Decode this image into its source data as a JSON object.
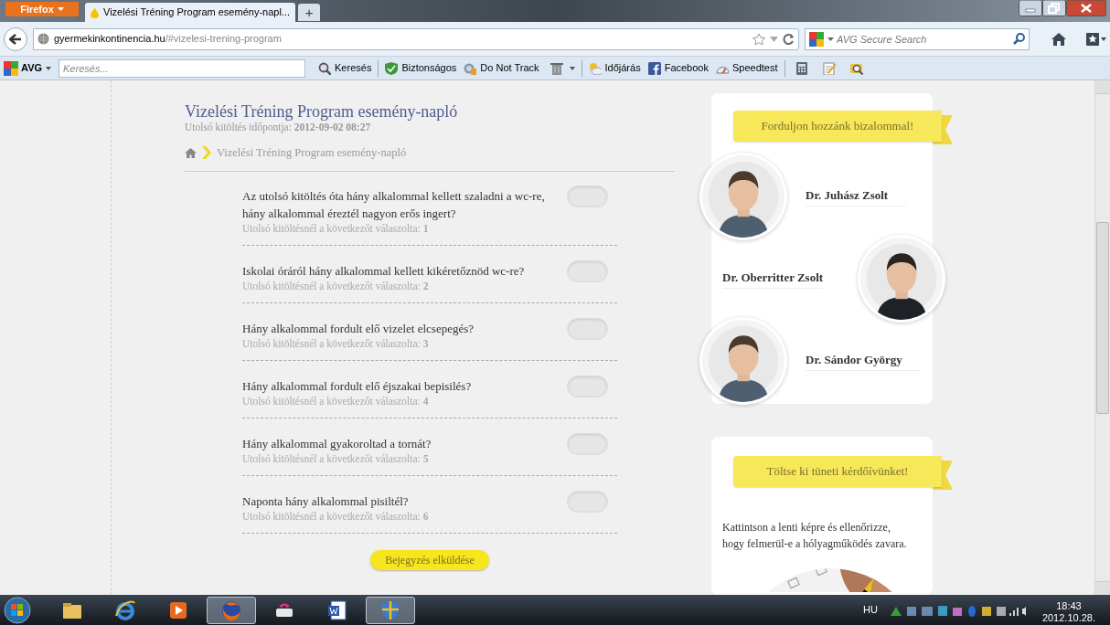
{
  "browser": {
    "menu_button": "Firefox",
    "tabs": [
      {
        "title": "Vizelési Tréning Program esemény-napl...",
        "selected": true
      }
    ],
    "new_tab": "+",
    "address": {
      "domain": "gyermekinkontinencia.hu",
      "path": "/#vizelesi-trening-program"
    },
    "search_placeholder": "AVG Secure Search",
    "toolbar": {
      "brand": "AVG",
      "search_placeholder": "Keresés...",
      "items": [
        {
          "kind": "search",
          "label": "Keresés"
        },
        {
          "kind": "shield",
          "label": "Biztonságos"
        },
        {
          "kind": "dnt",
          "label": "Do Not Track"
        },
        {
          "kind": "trash"
        },
        {
          "kind": "weather",
          "label": "Időjárás"
        },
        {
          "kind": "facebook",
          "label": "Facebook"
        },
        {
          "kind": "speedtest",
          "label": "Speedtest"
        },
        {
          "kind": "calculator"
        },
        {
          "kind": "notepad"
        },
        {
          "kind": "magnifier"
        }
      ]
    }
  },
  "page": {
    "title": "Vizelési Tréning Program esemény-napló",
    "last_filled": "Utolsó kitöltés időpontja: **2012-09-02 08:27**",
    "breadcrumb": "Vizelési Tréning Program esemény-napló",
    "questions": [
      {
        "text": "Az utolsó kitöltés óta hány alkalommal kellett szaladni a wc-re, hány alkalommal éreztél nagyon erős ingert?",
        "previous": "Utolsó kitöltésnél a következőt válaszolta: **1**"
      },
      {
        "text": "Iskolai óráról hány alkalommal kellett kikéretőznöd wc-re?",
        "previous": "Utolsó kitöltésnél a következőt válaszolta: **2**"
      },
      {
        "text": "Hány alkalommal fordult elő vizelet elcsepegés?",
        "previous": "Utolsó kitöltésnél a következőt válaszolta: **3**"
      },
      {
        "text": "Hány alkalommal fordult elő éjszakai bepisilés?",
        "previous": "Utolsó kitöltésnél a következőt válaszolta: **4**"
      },
      {
        "text": "Hány alkalommal gyakoroltad a tornát?",
        "previous": "Utolsó kitöltésnél a következőt válaszolta: **5**"
      },
      {
        "text": "Naponta hány alkalommal pisiltél?",
        "previous": "Utolsó kitöltésnél a következőt válaszolta: **6**"
      }
    ],
    "submit": "Bejegyzés elküldése"
  },
  "sidebar": {
    "contact_ribbon": "Forduljon hozzánk bizalommal!",
    "doctors": [
      {
        "name": "Dr. Juhász Zsolt",
        "kind": "photo_left"
      },
      {
        "name": "Dr. Oberritter Zsolt",
        "kind": "photo_right"
      },
      {
        "name": "Dr. Sándor György",
        "kind": "photo_left"
      }
    ],
    "survey_ribbon": "Töltse ki tüneti kérdőívünket!",
    "survey_text": "Kattintson a lenti képre és ellenőrizze, hogy felmerül-e a hólyagműködés zavara."
  },
  "taskbar": {
    "apps": [
      {
        "kind": "folder",
        "active": false
      },
      {
        "kind": "ie",
        "active": false
      },
      {
        "kind": "media",
        "active": false
      },
      {
        "kind": "firefox",
        "active": true
      },
      {
        "kind": "printer",
        "active": false
      },
      {
        "kind": "word",
        "active": false
      },
      {
        "kind": "shield",
        "active": true
      }
    ],
    "language": "HU",
    "time": "18:43",
    "date": "2012.10.28."
  }
}
